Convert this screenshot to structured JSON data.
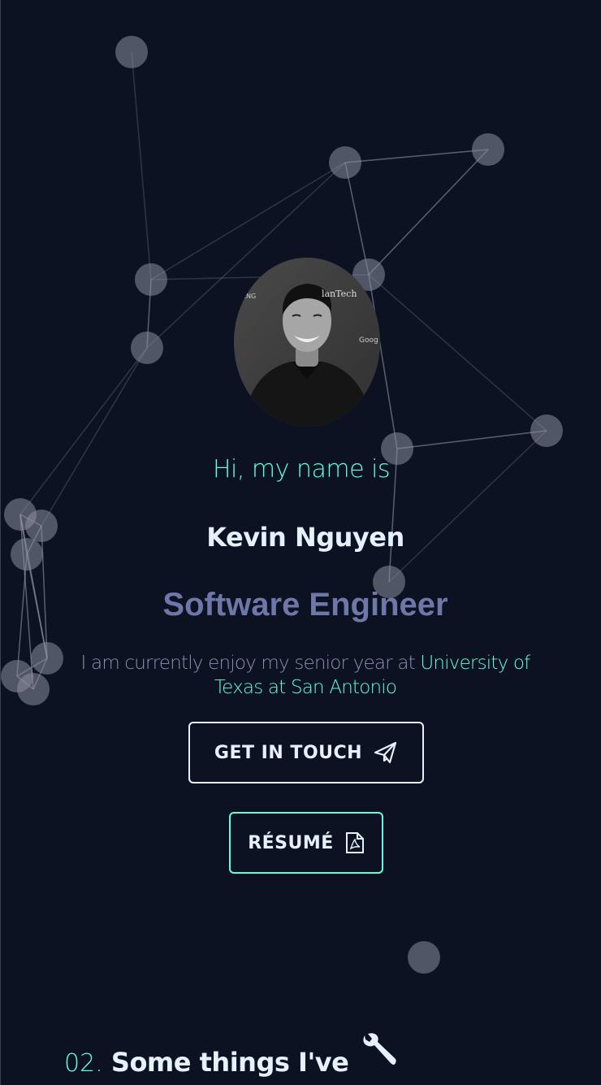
{
  "hero": {
    "greeting": "Hi, my name is",
    "name": "Kevin Nguyen",
    "role": "Software Engineer",
    "bio_prefix": "I am currently enjoy my senior year at ",
    "bio_highlight": "University of Texas at San Antonio"
  },
  "buttons": {
    "get_in_touch": "GET IN TOUCH",
    "resume": "RÉSUMÉ"
  },
  "section": {
    "number": "02.",
    "title": "Some things I've"
  },
  "icons": {
    "get_in_touch": "paper-plane-icon",
    "resume": "pdf-file-icon",
    "section": "wrench-icon"
  },
  "colors": {
    "background": "#0c1222",
    "accent": "#64ffda",
    "heading": "#e6f1ff",
    "role": "#6e78a8",
    "text": "#8892b0"
  }
}
